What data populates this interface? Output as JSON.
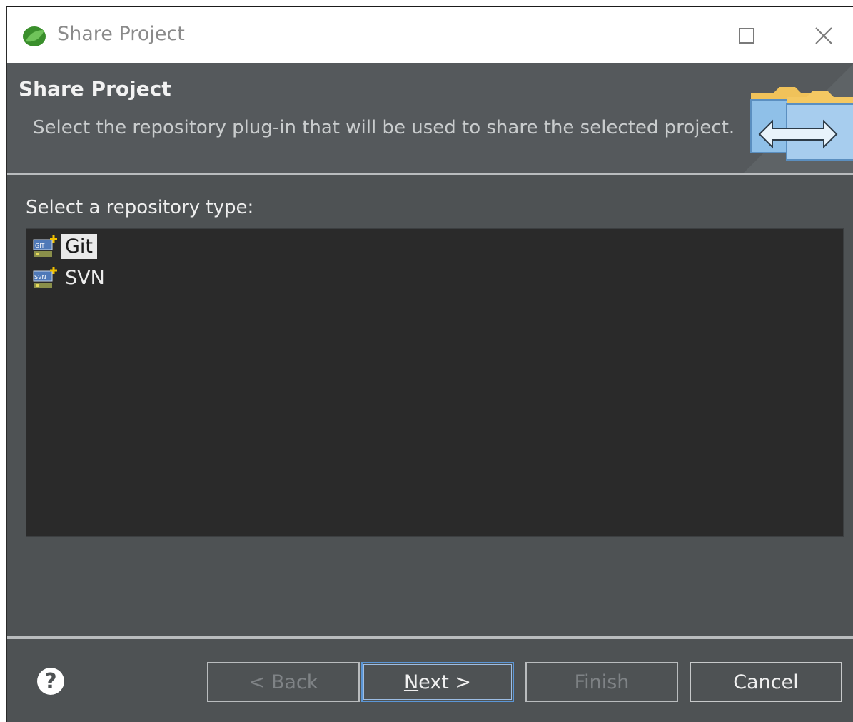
{
  "window": {
    "title": "Share Project"
  },
  "header": {
    "title": "Share Project",
    "description": "Select the repository plug-in that will be used to share the selected project."
  },
  "body": {
    "list_label": "Select a repository type:",
    "repositories": [
      {
        "label": "Git",
        "icon": "git-repo-icon",
        "selected": true
      },
      {
        "label": "SVN",
        "icon": "svn-repo-icon",
        "selected": false
      }
    ]
  },
  "footer": {
    "help_label": "?",
    "back_label": "< Back",
    "next_mnemonic": "N",
    "next_rest": "ext >",
    "finish_label": "Finish",
    "cancel_label": "Cancel"
  },
  "colors": {
    "dialog_bg": "#4e5254",
    "list_bg": "#2a2a2a",
    "default_button_border": "#5b96d6"
  }
}
